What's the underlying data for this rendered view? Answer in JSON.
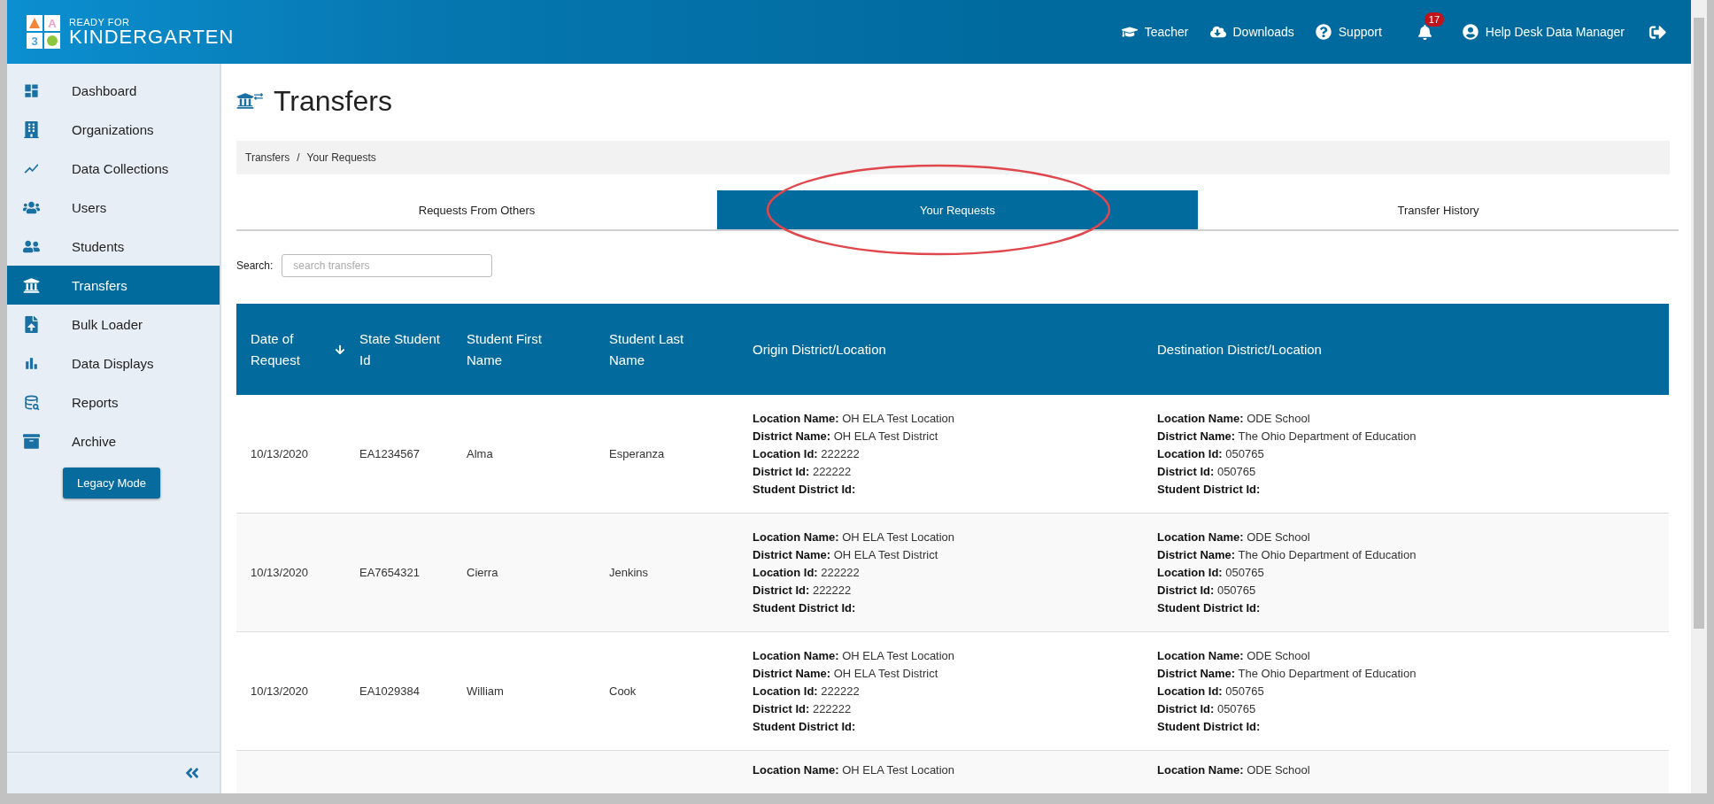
{
  "header": {
    "logo": {
      "tiles": [
        {
          "kind": "triangle",
          "color": "#f0873a"
        },
        {
          "kind": "letter",
          "text": "A",
          "color": "#e8a0c8"
        },
        {
          "kind": "letter",
          "text": "3",
          "color": "#4aa3df"
        },
        {
          "kind": "circle",
          "color": "#8cc63f"
        }
      ],
      "line1": "READY FOR",
      "line2": "KINDERGARTEN"
    },
    "nav": [
      {
        "label": "Teacher"
      },
      {
        "label": "Downloads"
      },
      {
        "label": "Support"
      }
    ],
    "notifications": {
      "count": "17"
    },
    "user": "Help Desk Data Manager"
  },
  "sidebar": {
    "items": [
      {
        "label": "Dashboard",
        "selected": false
      },
      {
        "label": "Organizations",
        "selected": false
      },
      {
        "label": "Data Collections",
        "selected": false
      },
      {
        "label": "Users",
        "selected": false
      },
      {
        "label": "Students",
        "selected": false
      },
      {
        "label": "Transfers",
        "selected": true
      },
      {
        "label": "Bulk Loader",
        "selected": false
      },
      {
        "label": "Data Displays",
        "selected": false
      },
      {
        "label": "Reports",
        "selected": false
      },
      {
        "label": "Archive",
        "selected": false
      }
    ],
    "button": "Legacy Mode"
  },
  "page": {
    "title": "Transfers",
    "breadcrumb": {
      "items": [
        "Transfers",
        "Your Requests"
      ],
      "separator": "/"
    }
  },
  "tabs": [
    {
      "label": "Requests From Others",
      "selected": false,
      "highlighted": false
    },
    {
      "label": "Your Requests",
      "selected": true,
      "highlighted": true
    },
    {
      "label": "Transfer History",
      "selected": false,
      "highlighted": false
    }
  ],
  "search": {
    "label": "Search:",
    "placeholder": "search transfers"
  },
  "table": {
    "columns": [
      {
        "label": "Date of Request",
        "sorted": true
      },
      {
        "label": "State Student Id",
        "sorted": false
      },
      {
        "label": "Student First Name",
        "sorted": false
      },
      {
        "label": "Student Last Name",
        "sorted": false
      },
      {
        "label": "Origin District/Location",
        "sorted": false
      },
      {
        "label": "Destination District/Location",
        "sorted": false
      }
    ],
    "rows": [
      {
        "date": "10/13/2020",
        "state_id": "EA1234567",
        "first_name": "Alma",
        "last_name": "Esperanza",
        "origin": [
          {
            "label": "Location Name:",
            "value": "OH ELA Test Location"
          },
          {
            "label": "District Name:",
            "value": "OH ELA Test District"
          },
          {
            "label": "Location Id:",
            "value": "222222"
          },
          {
            "label": "District Id:",
            "value": "222222"
          },
          {
            "label": "Student District Id:"
          }
        ],
        "destination": [
          {
            "label": "Location Name:",
            "value": "ODE School"
          },
          {
            "label": "District Name:",
            "value": "The Ohio Department of Education"
          },
          {
            "label": "Location Id:",
            "value": "050765"
          },
          {
            "label": "District Id:",
            "value": "050765"
          },
          {
            "label": "Student District Id:"
          }
        ]
      },
      {
        "date": "10/13/2020",
        "state_id": "EA7654321",
        "first_name": "Cierra",
        "last_name": "Jenkins",
        "origin": [
          {
            "label": "Location Name:",
            "value": "OH ELA Test Location"
          },
          {
            "label": "District Name:",
            "value": "OH ELA Test District"
          },
          {
            "label": "Location Id:",
            "value": "222222"
          },
          {
            "label": "District Id:",
            "value": "222222"
          },
          {
            "label": "Student District Id:"
          }
        ],
        "destination": [
          {
            "label": "Location Name:",
            "value": "ODE School"
          },
          {
            "label": "District Name:",
            "value": "The Ohio Department of Education"
          },
          {
            "label": "Location Id:",
            "value": "050765"
          },
          {
            "label": "District Id:",
            "value": "050765"
          },
          {
            "label": "Student District Id:"
          }
        ]
      },
      {
        "date": "10/13/2020",
        "state_id": "EA1029384",
        "first_name": "William",
        "last_name": "Cook",
        "origin": [
          {
            "label": "Location Name:",
            "value": "OH ELA Test Location"
          },
          {
            "label": "District Name:",
            "value": "OH ELA Test District"
          },
          {
            "label": "Location Id:",
            "value": "222222"
          },
          {
            "label": "District Id:",
            "value": "222222"
          },
          {
            "label": "Student District Id:"
          }
        ],
        "destination": [
          {
            "label": "Location Name:",
            "value": "ODE School"
          },
          {
            "label": "District Name:",
            "value": "The Ohio Department of Education"
          },
          {
            "label": "Location Id:",
            "value": "050765"
          },
          {
            "label": "District Id:",
            "value": "050765"
          },
          {
            "label": "Student District Id:"
          }
        ]
      },
      {
        "origin": [
          {
            "label": "Location Name:",
            "value": "OH ELA Test Location"
          }
        ],
        "destination": [
          {
            "label": "Location Name:",
            "value": "ODE School"
          }
        ]
      }
    ]
  }
}
